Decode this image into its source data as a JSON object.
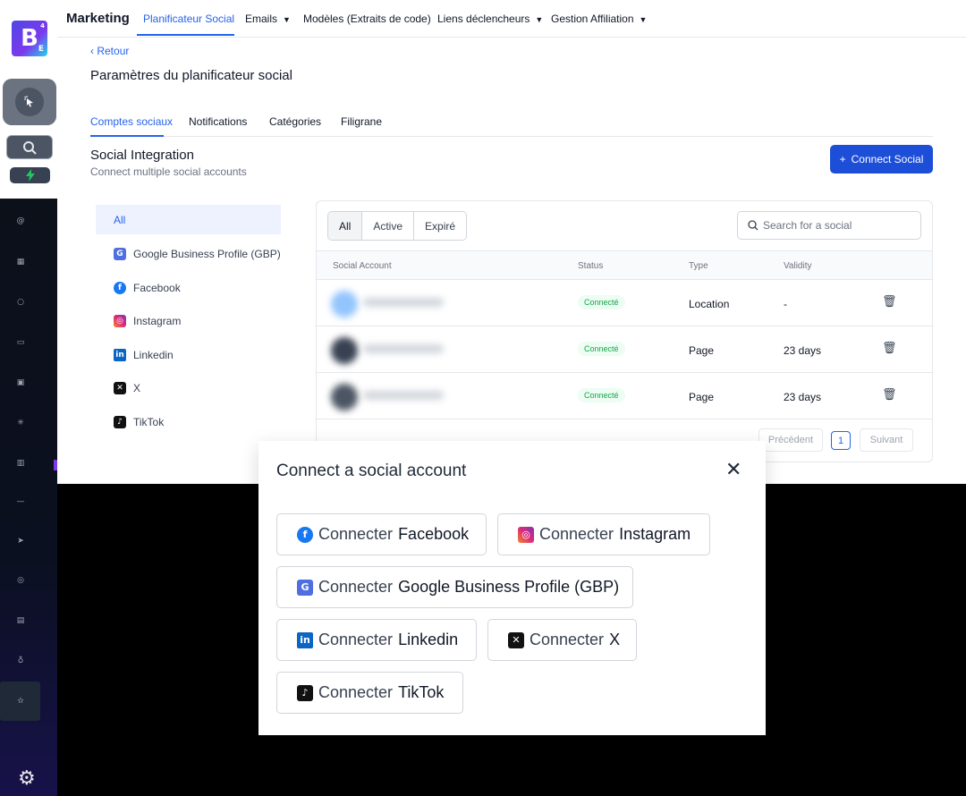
{
  "sidebar": {
    "logo_letter": "B",
    "logo_sub": "E",
    "logo_sup": "4",
    "icons": [
      "cursor-click-icon",
      "search-icon",
      "bolt-icon",
      "at-icon",
      "grid-icon",
      "chat-icon",
      "calendar-icon",
      "inbox-icon",
      "asterisk-icon",
      "building-icon",
      "minus-icon",
      "send-icon",
      "target-icon",
      "store-icon",
      "bulb-icon",
      "star-icon",
      "gear-icon"
    ]
  },
  "topbar": {
    "brand": "Marketing",
    "nav": [
      {
        "label": "Planificateur Social"
      },
      {
        "label": "Emails"
      },
      {
        "label": "Modèles (Extraits de code)"
      },
      {
        "label": "Liens déclencheurs"
      },
      {
        "label": "Gestion Affiliation"
      }
    ]
  },
  "page": {
    "back_label": "Retour",
    "title": "Paramètres du planificateur social",
    "tabs": [
      "Comptes sociaux",
      "Notifications",
      "Catégories",
      "Filigrane"
    ],
    "section_title": "Social Integration",
    "section_subtitle": "Connect multiple social accounts",
    "connect_button": "Connect Social"
  },
  "filters": [
    "All",
    "Google Business Profile (GBP)",
    "Facebook",
    "Instagram",
    "Linkedin",
    "X",
    "TikTok"
  ],
  "table": {
    "segments": [
      "All",
      "Active",
      "Expiré"
    ],
    "search_placeholder": "Search for a social",
    "columns": [
      "Social Account",
      "Status",
      "Type",
      "Validity"
    ],
    "rows": [
      {
        "status": "Connecté",
        "type": "Location",
        "validity": "-"
      },
      {
        "status": "Connecté",
        "type": "Page",
        "validity": "23 days"
      },
      {
        "status": "Connecté",
        "type": "Page",
        "validity": "23 days"
      }
    ],
    "pagination": {
      "prev": "Précédent",
      "page": "1",
      "next": "Suivant"
    }
  },
  "modal": {
    "title": "Connect a social account",
    "close": "✕",
    "prefix": "Connecter",
    "buttons": [
      "Facebook",
      "Instagram",
      "Google Business Profile (GBP)",
      "Linkedin",
      "X",
      "TikTok"
    ]
  }
}
